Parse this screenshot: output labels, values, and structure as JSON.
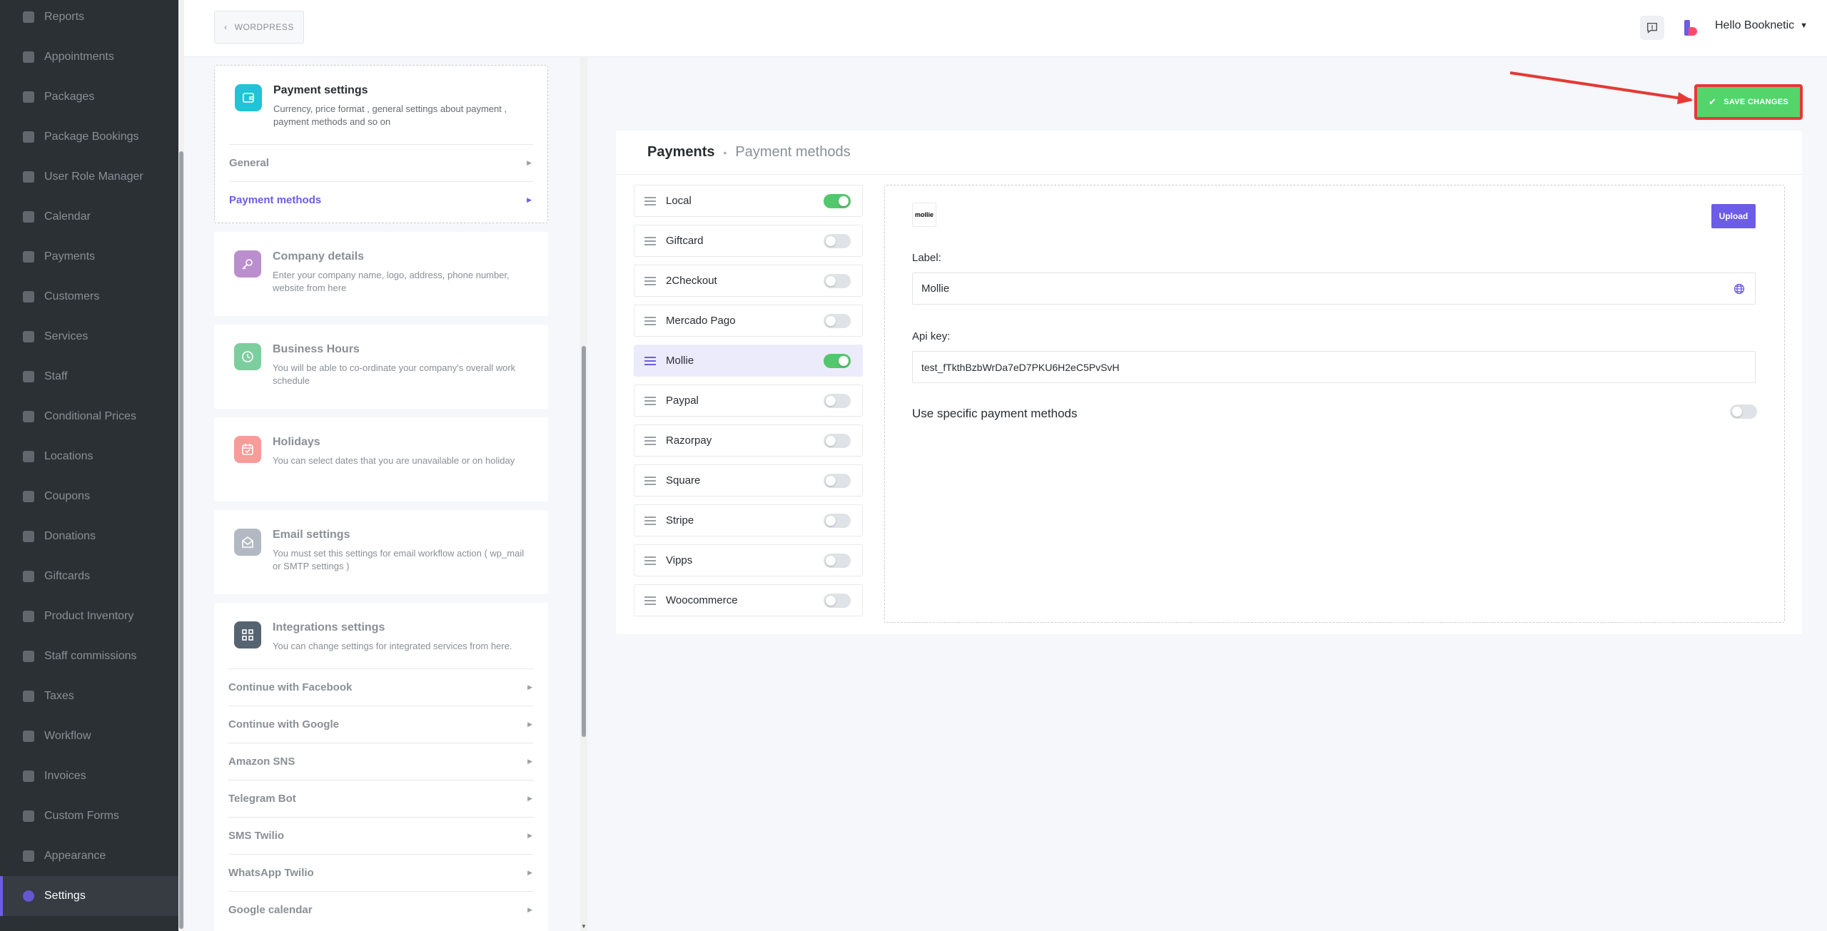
{
  "sidebar": {
    "items": [
      {
        "label": "Reports",
        "icon": "chart-icon"
      },
      {
        "label": "Appointments",
        "icon": "clock-icon"
      },
      {
        "label": "Packages",
        "icon": "box-icon"
      },
      {
        "label": "Package Bookings",
        "icon": "package-bookings-icon"
      },
      {
        "label": "User Role Manager",
        "icon": "user-role-icon"
      },
      {
        "label": "Calendar",
        "icon": "calendar-icon"
      },
      {
        "label": "Payments",
        "icon": "credit-card-icon"
      },
      {
        "label": "Customers",
        "icon": "users-icon"
      },
      {
        "label": "Services",
        "icon": "list-icon"
      },
      {
        "label": "Staff",
        "icon": "user-icon"
      },
      {
        "label": "Conditional Prices",
        "icon": "cursor-icon"
      },
      {
        "label": "Locations",
        "icon": "location-icon"
      },
      {
        "label": "Coupons",
        "icon": "tag-icon"
      },
      {
        "label": "Donations",
        "icon": "donation-icon"
      },
      {
        "label": "Giftcards",
        "icon": "gift-icon"
      },
      {
        "label": "Product Inventory",
        "icon": "inventory-icon"
      },
      {
        "label": "Staff commissions",
        "icon": "commission-icon"
      },
      {
        "label": "Taxes",
        "icon": "percent-icon"
      },
      {
        "label": "Workflow",
        "icon": "workflow-icon"
      },
      {
        "label": "Invoices",
        "icon": "invoice-icon"
      },
      {
        "label": "Custom Forms",
        "icon": "form-icon"
      },
      {
        "label": "Appearance",
        "icon": "brush-icon"
      },
      {
        "label": "Settings",
        "icon": "gear-icon",
        "active": true
      }
    ]
  },
  "topbar": {
    "back_label": "WORDPRESS",
    "user_greeting": "Hello Booknetic"
  },
  "settings_cards": {
    "payment": {
      "title": "Payment settings",
      "desc": "Currency, price format , general settings about payment , payment methods and so on",
      "sub_general": "General",
      "sub_methods": "Payment methods"
    },
    "company": {
      "title": "Company details",
      "desc": "Enter your company name, logo, address, phone number, website from here"
    },
    "hours": {
      "title": "Business Hours",
      "desc": "You will be able to co-ordinate your company's overall work schedule"
    },
    "holidays": {
      "title": "Holidays",
      "desc": "You can select dates that you are unavailable or on holiday"
    },
    "email": {
      "title": "Email settings",
      "desc": "You must set this settings for email workflow action ( wp_mail or SMTP settings )"
    },
    "integrations": {
      "title": "Integrations settings",
      "desc": "You can change settings for integrated services from here.",
      "items": [
        "Continue with Facebook",
        "Continue with Google",
        "Amazon SNS",
        "Telegram Bot",
        "SMS Twilio",
        "WhatsApp Twilio",
        "Google calendar"
      ]
    }
  },
  "toolbar": {
    "save_label": "SAVE CHANGES"
  },
  "main": {
    "title": "Payments",
    "subtitle": "Payment methods",
    "gateways": [
      {
        "name": "Local",
        "enabled": true
      },
      {
        "name": "Giftcard",
        "enabled": false
      },
      {
        "name": "2Checkout",
        "enabled": false
      },
      {
        "name": "Mercado Pago",
        "enabled": false
      },
      {
        "name": "Mollie",
        "enabled": true,
        "selected": true
      },
      {
        "name": "Paypal",
        "enabled": false
      },
      {
        "name": "Razorpay",
        "enabled": false
      },
      {
        "name": "Square",
        "enabled": false
      },
      {
        "name": "Stripe",
        "enabled": false
      },
      {
        "name": "Vipps",
        "enabled": false
      },
      {
        "name": "Woocommerce",
        "enabled": false
      }
    ],
    "detail": {
      "logo_text": "mollie",
      "upload_label": "Upload",
      "label_caption": "Label:",
      "label_value": "Mollie",
      "apikey_caption": "Api key:",
      "apikey_value": "test_fTkthBzbWrDa7eD7PKU6H2eC5PvSvH",
      "specific_label": "Use specific payment methods",
      "specific_enabled": false
    }
  },
  "colors": {
    "accent": "#6c5ce7",
    "save_green": "#53d56c",
    "annotation_red": "#e53935",
    "toggle_on": "#53c76b",
    "sidebar_bg": "#2b3035"
  }
}
